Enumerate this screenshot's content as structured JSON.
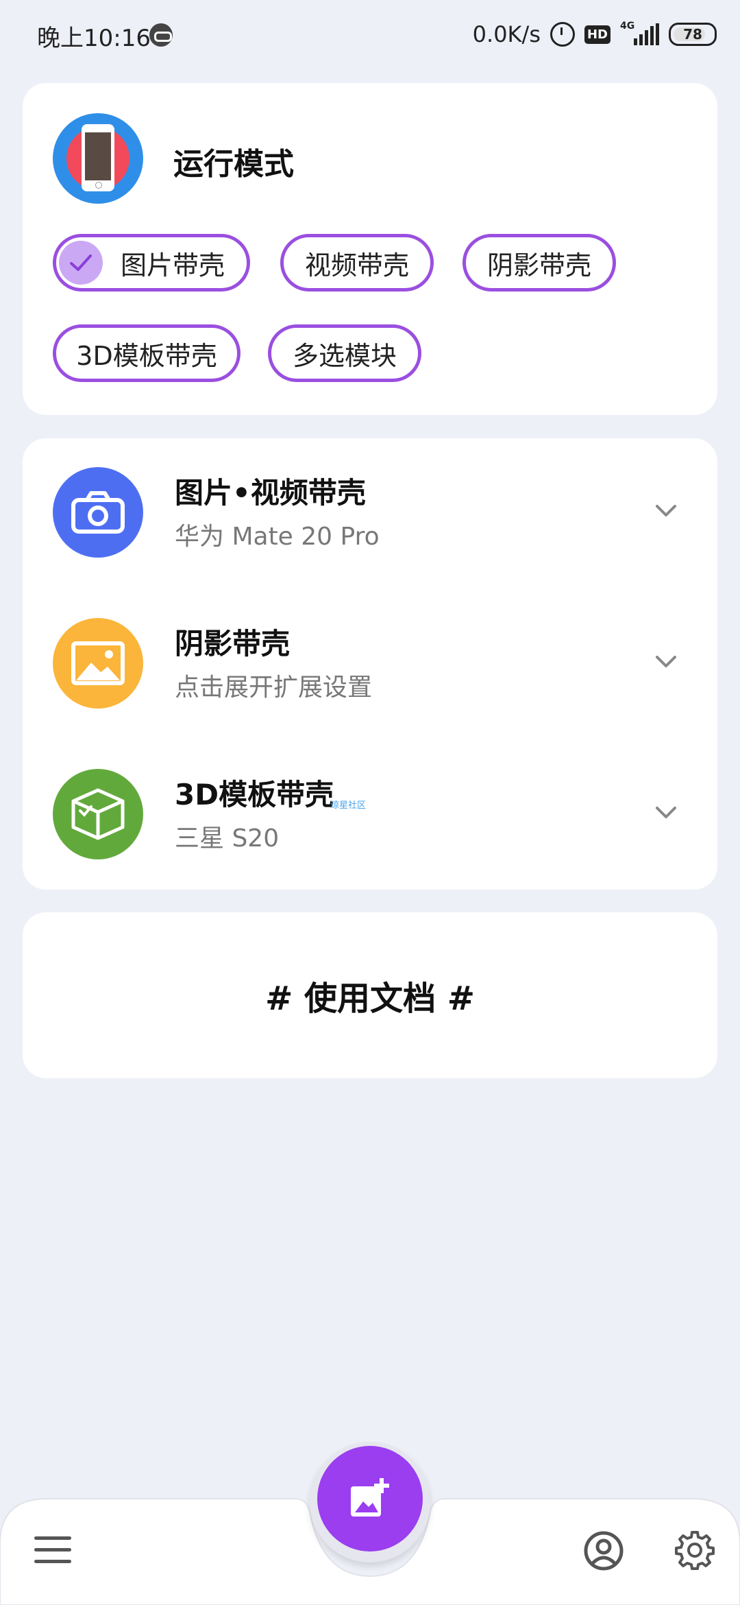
{
  "status_bar": {
    "time": "晚上10:16",
    "net_speed": "0.0K/s",
    "hd_label": "HD",
    "network_type": "4G",
    "battery": "78"
  },
  "mode_card": {
    "title": "运行模式",
    "chips": [
      {
        "label": "图片带壳",
        "selected": true
      },
      {
        "label": "视频带壳",
        "selected": false
      },
      {
        "label": "阴影带壳",
        "selected": false
      },
      {
        "label": "3D模板带壳",
        "selected": false
      },
      {
        "label": "多选模块",
        "selected": false
      }
    ],
    "accent_color": "#9a4fe0"
  },
  "list_card": {
    "items": [
      {
        "title": "图片•视频带壳",
        "subtitle": "华为 Mate 20 Pro",
        "icon": "camera-icon",
        "color": "#4e6ef2"
      },
      {
        "title": "阴影带壳",
        "subtitle": "点击展开扩展设置",
        "icon": "image-icon",
        "color": "#fbb53a"
      },
      {
        "title": "3D模板带壳",
        "subtitle": "三星 S20",
        "icon": "3d-box-icon",
        "color": "#62a93c"
      }
    ],
    "watermark": "琼星社区"
  },
  "docs_card": {
    "title": "# 使用文档 #"
  },
  "bottom_bar": {
    "fab_icon": "add-image-icon",
    "left_icon": "menu-icon",
    "right_icons": [
      "profile-icon",
      "gear-icon"
    ]
  }
}
